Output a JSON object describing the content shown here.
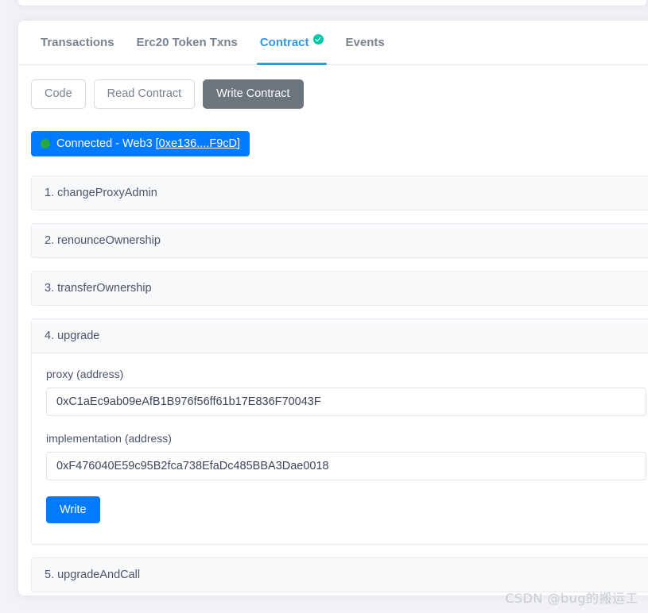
{
  "tabs": [
    {
      "label": "Transactions",
      "active": false,
      "verified": false
    },
    {
      "label": "Erc20 Token Txns",
      "active": false,
      "verified": false
    },
    {
      "label": "Contract",
      "active": true,
      "verified": true
    },
    {
      "label": "Events",
      "active": false,
      "verified": false
    }
  ],
  "sub_buttons": [
    {
      "label": "Code",
      "style": "outline"
    },
    {
      "label": "Read Contract",
      "style": "outline"
    },
    {
      "label": "Write Contract",
      "style": "solid"
    }
  ],
  "wallet": {
    "status_text": "Connected - Web3",
    "address": "[0xe136....F9cD]",
    "dot_color": "#28a745",
    "background": "#007bff"
  },
  "methods": [
    {
      "title": "1. changeProxyAdmin",
      "open": false
    },
    {
      "title": "2. renounceOwnership",
      "open": false
    },
    {
      "title": "3. transferOwnership",
      "open": false
    },
    {
      "title": "4. upgrade",
      "open": true,
      "fields": [
        {
          "label": "proxy (address)",
          "value": "0xC1aEc9ab09eAfB1B976f56ff61b17E836F70043F",
          "placeholder": "proxy (address)"
        },
        {
          "label": "implementation (address)",
          "value": "0xF476040E59c95B2fca738EfaDc485BBA3Dae0018",
          "placeholder": "implementation (address)"
        }
      ],
      "submit_label": "Write"
    },
    {
      "title": "5. upgradeAndCall",
      "open": false
    }
  ],
  "watermark": "CSDN @bug的搬运工",
  "colors": {
    "accent": "#3498db",
    "primary": "#007bff",
    "verified": "#00c9a7",
    "muted": "#77838f"
  }
}
